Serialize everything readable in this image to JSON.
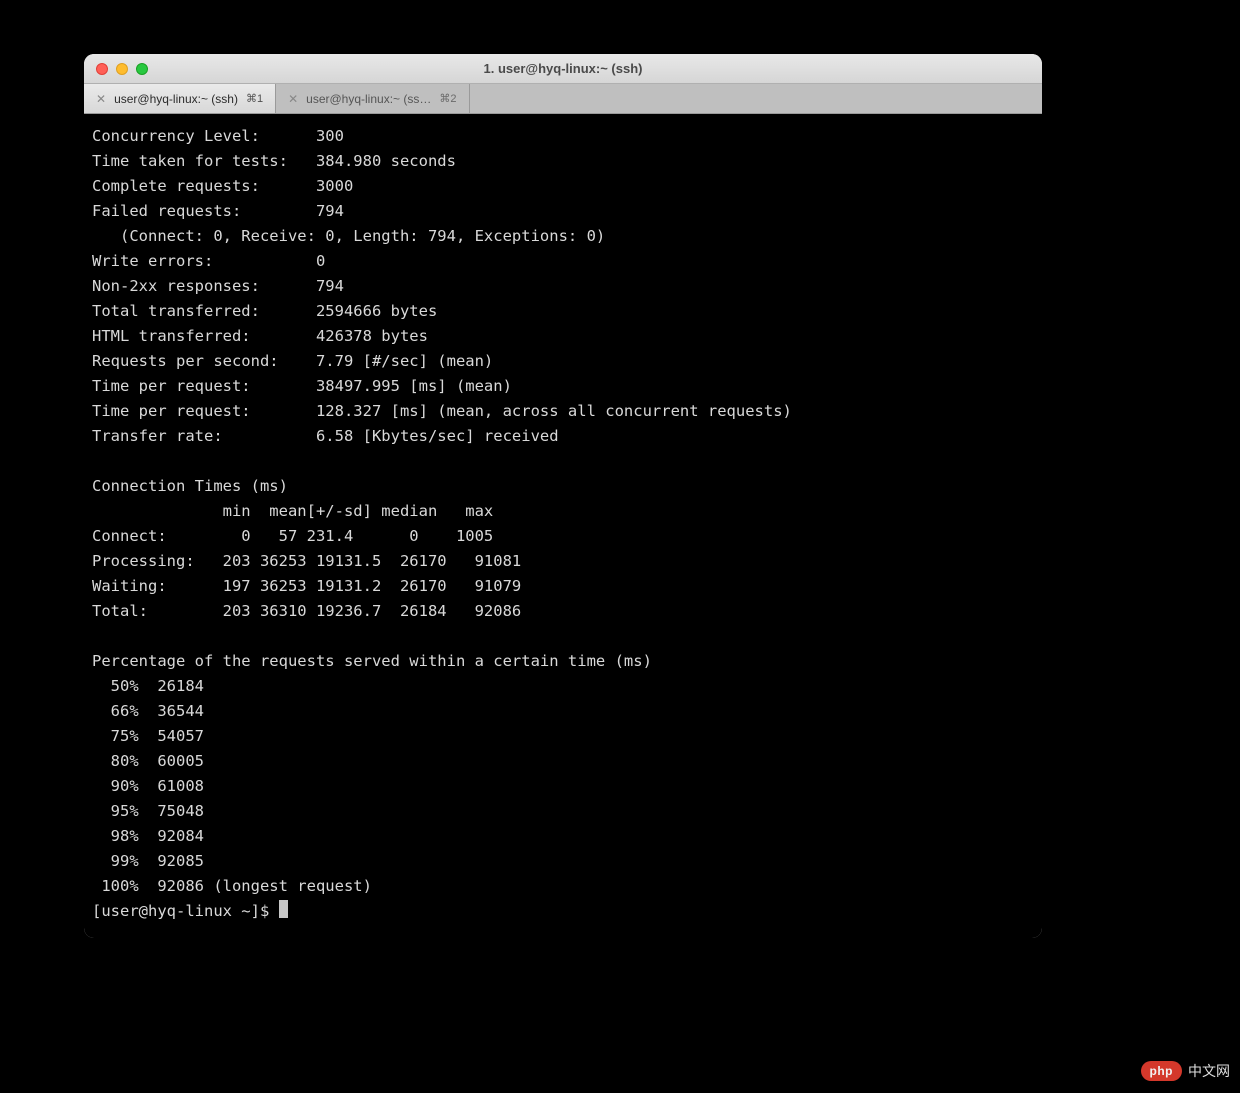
{
  "window": {
    "title": "1. user@hyq-linux:~ (ssh)"
  },
  "tabs": [
    {
      "label": "user@hyq-linux:~ (ssh)",
      "shortcut": "⌘1",
      "active": true
    },
    {
      "label": "user@hyq-linux:~ (ss…",
      "shortcut": "⌘2",
      "active": false
    }
  ],
  "bench": {
    "concurrency": "Concurrency Level:      300",
    "time_taken": "Time taken for tests:   384.980 seconds",
    "complete": "Complete requests:      3000",
    "failed": "Failed requests:        794",
    "failed_detail": "   (Connect: 0, Receive: 0, Length: 794, Exceptions: 0)",
    "write_errors": "Write errors:           0",
    "non2xx": "Non-2xx responses:      794",
    "total_transferred": "Total transferred:      2594666 bytes",
    "html_transferred": "HTML transferred:       426378 bytes",
    "rps": "Requests per second:    7.79 [#/sec] (mean)",
    "tpr1": "Time per request:       38497.995 [ms] (mean)",
    "tpr2": "Time per request:       128.327 [ms] (mean, across all concurrent requests)",
    "transfer_rate": "Transfer rate:          6.58 [Kbytes/sec] received"
  },
  "conn": {
    "header": "Connection Times (ms)",
    "cols": "              min  mean[+/-sd] median   max",
    "connect": "Connect:        0   57 231.4      0    1005",
    "processing": "Processing:   203 36253 19131.5  26170   91081",
    "waiting": "Waiting:      197 36253 19131.2  26170   91079",
    "total": "Total:        203 36310 19236.7  26184   92086"
  },
  "pct": {
    "header": "Percentage of the requests served within a certain time (ms)",
    "p50": "  50%  26184",
    "p66": "  66%  36544",
    "p75": "  75%  54057",
    "p80": "  80%  60005",
    "p90": "  90%  61008",
    "p95": "  95%  75048",
    "p98": "  98%  92084",
    "p99": "  99%  92085",
    "p100": " 100%  92086 (longest request)"
  },
  "prompt": "[user@hyq-linux ~]$ ",
  "watermark": {
    "badge": "php",
    "text": "中文网"
  }
}
